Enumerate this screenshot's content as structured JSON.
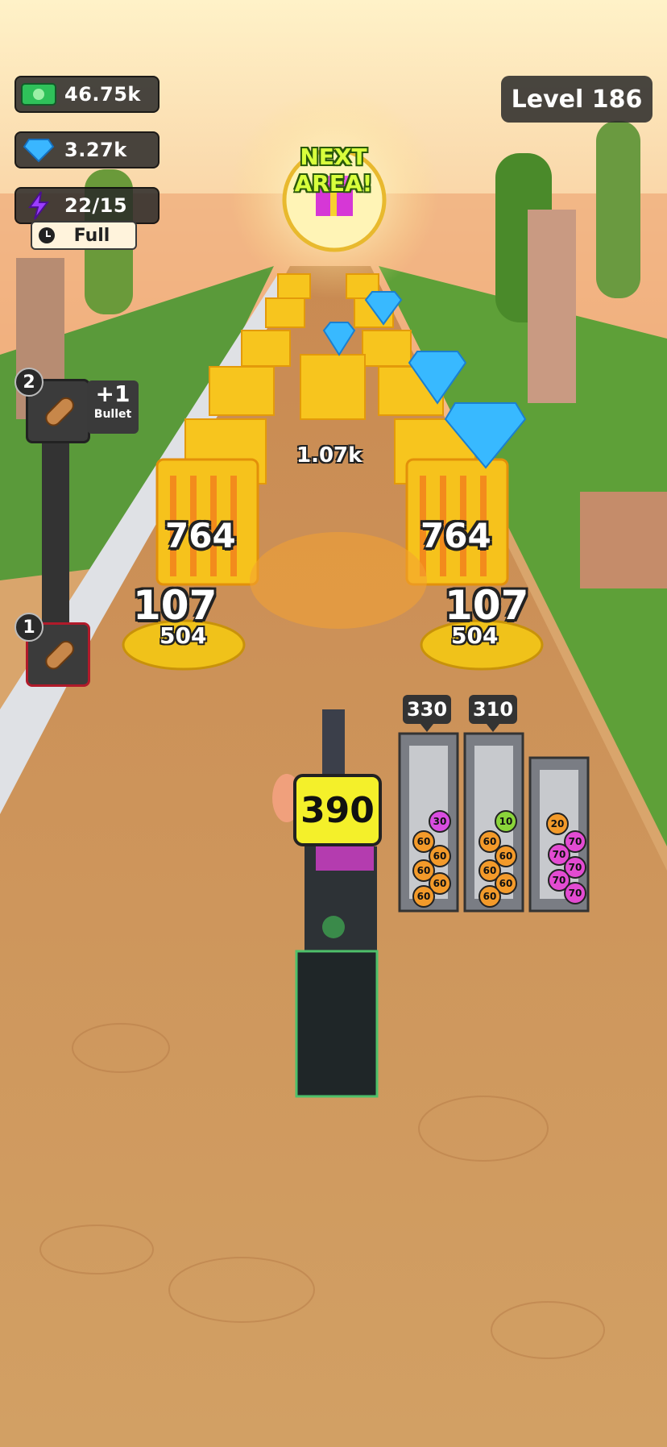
{
  "hud": {
    "cash": "46.75k",
    "gems": "3.27k",
    "energy": "22/15",
    "energy_status": "Full",
    "level": "Level 186"
  },
  "next_area": {
    "label": "NEXT AREA!"
  },
  "track": {
    "far_label": "1.07k",
    "left_barrel": "764",
    "right_barrel": "764",
    "left_coin_top": "107",
    "left_coin_bottom": "504",
    "right_coin_top": "107",
    "right_coin_bottom": "504"
  },
  "upgrade": {
    "slot_top_num": "2",
    "slot_bottom_num": "1",
    "bonus_value": "+1",
    "bonus_label": "Bullet"
  },
  "gun": {
    "power": "390"
  },
  "magazines": [
    {
      "tag": "330",
      "balls": [
        "30",
        "60",
        "60",
        "60",
        "60",
        "60"
      ]
    },
    {
      "tag": "310",
      "balls": [
        "10",
        "60",
        "60",
        "60",
        "60",
        "60"
      ]
    },
    {
      "tag": "",
      "balls": [
        "20",
        "70",
        "70",
        "70",
        "70",
        "70"
      ]
    }
  ],
  "colors": {
    "cash_green": "#2fc15a",
    "gem_blue": "#3ab6ff",
    "energy_purple": "#9b3cff",
    "barrel_yellow": "#f6c21c",
    "gun_badge": "#f4f02a"
  }
}
